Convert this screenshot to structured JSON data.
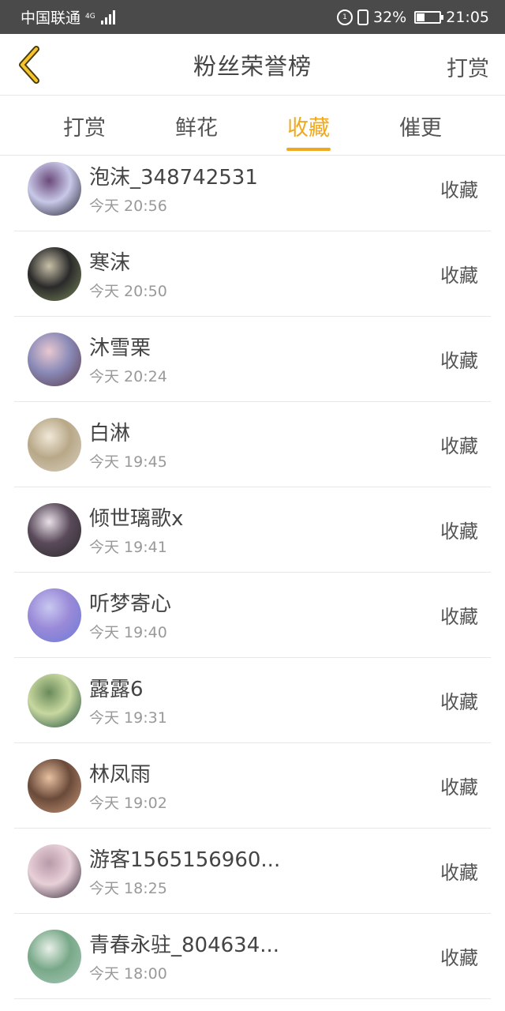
{
  "status_bar": {
    "carrier": "中国联通",
    "network": "4G",
    "battery": "32%",
    "time": "21:05"
  },
  "nav": {
    "title": "粉丝荣誉榜",
    "action": "打赏"
  },
  "tabs": [
    {
      "label": "打赏",
      "active": false
    },
    {
      "label": "鲜花",
      "active": false
    },
    {
      "label": "收藏",
      "active": true
    },
    {
      "label": "催更",
      "active": false
    }
  ],
  "colors": {
    "accent": "#f0a820",
    "status_bar_bg": "#4a4a4a"
  },
  "list": [
    {
      "name": "泡沫_348742531",
      "time": "今天 20:56",
      "action": "收藏"
    },
    {
      "name": "寒沫",
      "time": "今天 20:50",
      "action": "收藏"
    },
    {
      "name": "沐雪栗",
      "time": "今天 20:24",
      "action": "收藏"
    },
    {
      "name": "白淋",
      "time": "今天 19:45",
      "action": "收藏"
    },
    {
      "name": "倾世璃歌x",
      "time": "今天 19:41",
      "action": "收藏"
    },
    {
      "name": "听梦寄心",
      "time": "今天 19:40",
      "action": "收藏"
    },
    {
      "name": "露露6",
      "time": "今天 19:31",
      "action": "收藏"
    },
    {
      "name": "林凤雨",
      "time": "今天 19:02",
      "action": "收藏"
    },
    {
      "name": "游客1565156960...",
      "time": "今天 18:25",
      "action": "收藏"
    },
    {
      "name": "青春永驻_804634...",
      "time": "今天 18:00",
      "action": "收藏"
    }
  ]
}
